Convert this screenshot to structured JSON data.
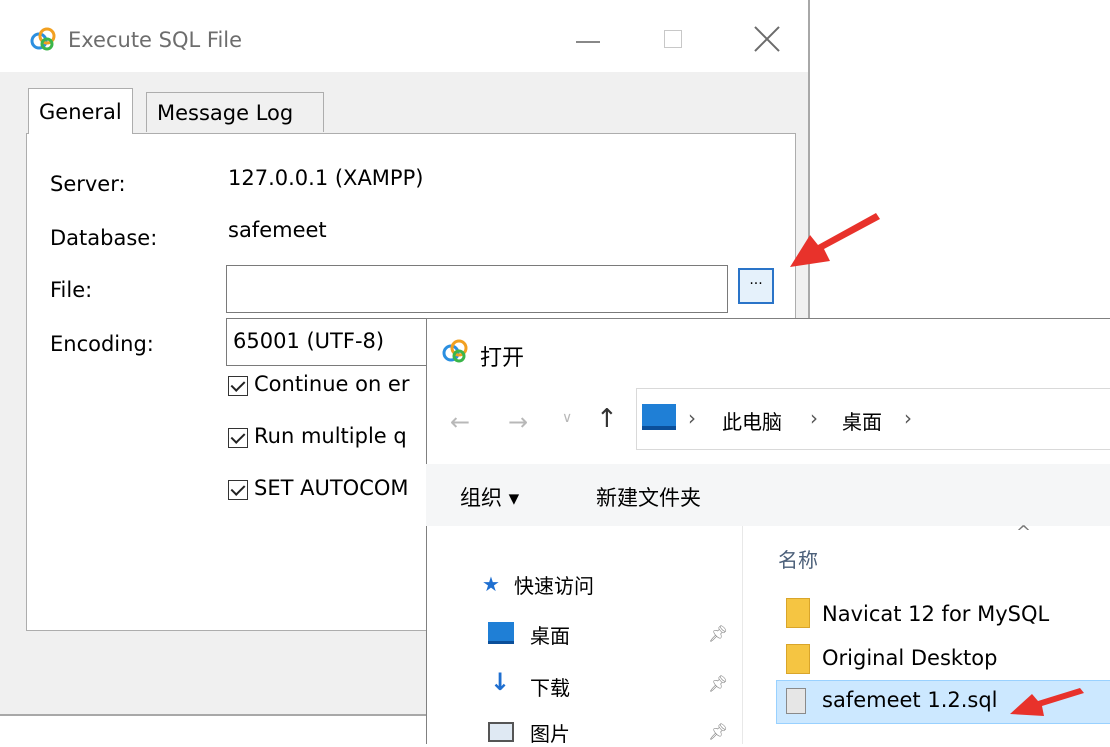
{
  "sql_dialog": {
    "title": "Execute SQL File",
    "tabs": [
      "General",
      "Message Log"
    ],
    "server_label": "Server:",
    "server_value": "127.0.0.1 (XAMPP)",
    "database_label": "Database:",
    "database_value": "safemeet",
    "file_label": "File:",
    "file_value": "",
    "browse_label": "...",
    "encoding_label": "Encoding:",
    "encoding_value": "65001 (UTF-8)",
    "checkboxes": [
      {
        "label": "Continue on er",
        "checked": true
      },
      {
        "label": "Run multiple q",
        "checked": true
      },
      {
        "label": "SET AUTOCOM",
        "checked": true
      }
    ]
  },
  "open_dialog": {
    "title": "打开",
    "breadcrumb": [
      "此电脑",
      "桌面"
    ],
    "toolbar": {
      "organize": "组织 ▾",
      "new_folder": "新建文件夹"
    },
    "nav": {
      "quick_access": "快速访问",
      "items": [
        "桌面",
        "下载",
        "图片"
      ]
    },
    "column_header": "名称",
    "files": [
      {
        "name": "Navicat 12 for MySQL",
        "type": "folder"
      },
      {
        "name": "Original Desktop",
        "type": "folder"
      },
      {
        "name": "safemeet 1.2.sql",
        "type": "sql-file",
        "selected": true
      }
    ]
  },
  "accent_colors": {
    "arrow": "#e8322b",
    "selection": "#cce8ff",
    "focus_border": "#2a74c8"
  }
}
